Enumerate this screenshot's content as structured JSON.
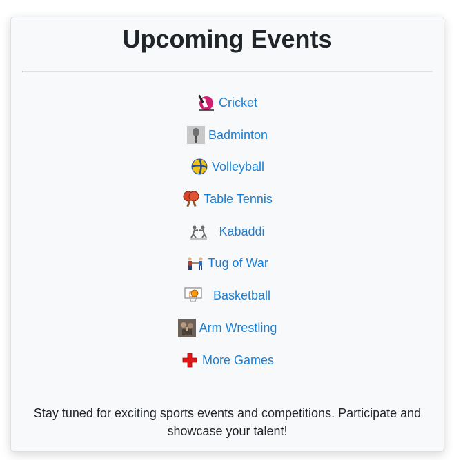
{
  "page": {
    "title": "Upcoming Events",
    "footer_text": "Stay tuned for exciting sports events and competitions. Participate and showcase your talent!"
  },
  "events": [
    {
      "label": "Cricket",
      "icon": "cricket-icon"
    },
    {
      "label": "Badminton",
      "icon": "badminton-icon"
    },
    {
      "label": "Volleyball",
      "icon": "volleyball-icon"
    },
    {
      "label": "Table Tennis",
      "icon": "table-tennis-icon"
    },
    {
      "label": "Kabaddi",
      "icon": "kabaddi-icon"
    },
    {
      "label": "Tug of War",
      "icon": "tug-of-war-icon"
    },
    {
      "label": "Basketball",
      "icon": "basketball-icon"
    },
    {
      "label": "Arm Wrestling",
      "icon": "arm-wrestling-icon"
    },
    {
      "label": "More Games",
      "icon": "plus-icon"
    }
  ],
  "colors": {
    "link": "#1a7fd6",
    "heading": "#212529",
    "card_background": "#f8f9fa"
  }
}
